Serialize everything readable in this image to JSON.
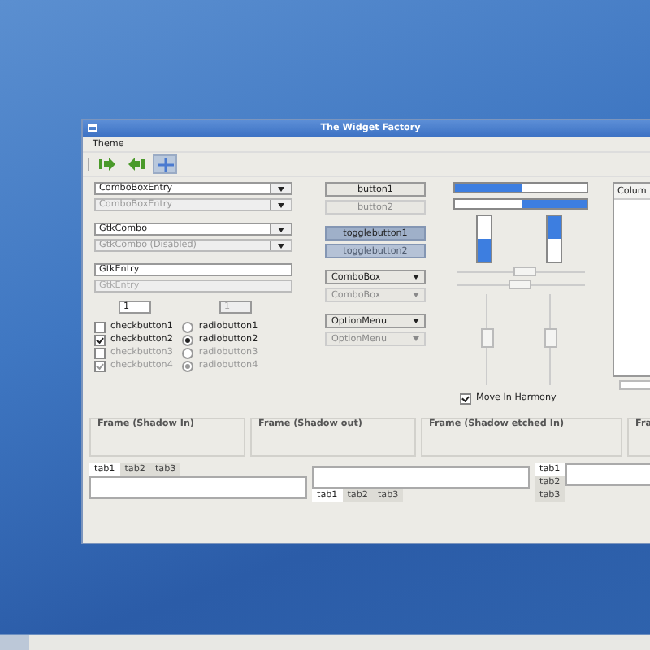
{
  "window": {
    "title": "The Widget Factory"
  },
  "menu": [
    {
      "label": "Theme"
    }
  ],
  "toolbar": [
    {
      "selected": false
    },
    {
      "selected": false
    },
    {
      "selected": true
    }
  ],
  "combos": [
    {
      "text": "ComboBoxEntry",
      "disabled": false
    },
    {
      "text": "ComboBoxEntry",
      "disabled": true
    },
    {
      "text": "GtkCombo",
      "disabled": false
    },
    {
      "text": "GtkCombo (Disabled)",
      "disabled": true
    }
  ],
  "entries": [
    {
      "value": "GtkEntry",
      "disabled": false
    },
    {
      "value": "GtkEntry",
      "disabled": true
    }
  ],
  "spins": [
    {
      "value": "1",
      "disabled": false
    },
    {
      "value": "1",
      "disabled": true
    }
  ],
  "checks": [
    {
      "label": "checkbutton1",
      "checked": false,
      "disabled": false
    },
    {
      "label": "checkbutton2",
      "checked": true,
      "disabled": false
    },
    {
      "label": "checkbutton3",
      "checked": false,
      "disabled": true
    },
    {
      "label": "checkbutton4",
      "checked": true,
      "disabled": true
    }
  ],
  "radios": [
    {
      "label": "radiobutton1",
      "selected": false,
      "disabled": false
    },
    {
      "label": "radiobutton2",
      "selected": true,
      "disabled": false
    },
    {
      "label": "radiobutton3",
      "selected": false,
      "disabled": true
    },
    {
      "label": "radiobutton4",
      "selected": true,
      "disabled": true
    }
  ],
  "buttons": [
    {
      "kind": "button",
      "label": "button1",
      "disabled": false,
      "on": false
    },
    {
      "kind": "button",
      "label": "button2",
      "disabled": true,
      "on": false
    },
    {
      "kind": "toggle",
      "label": "togglebutton1",
      "disabled": false,
      "on": true
    },
    {
      "kind": "toggle",
      "label": "togglebutton2",
      "disabled": true,
      "on": true
    },
    {
      "kind": "combo",
      "label": "ComboBox",
      "disabled": false,
      "on": false
    },
    {
      "kind": "combo",
      "label": "ComboBox",
      "disabled": true,
      "on": false
    },
    {
      "kind": "combo",
      "label": "OptionMenu",
      "disabled": false,
      "on": false
    },
    {
      "kind": "combo",
      "label": "OptionMenu",
      "disabled": true,
      "on": false
    }
  ],
  "hprogress": [
    {
      "level": 0.5,
      "inverted": false
    },
    {
      "level": 0.5,
      "inverted": true
    }
  ],
  "vprogress": [
    {
      "level": 0.5,
      "inverted": false
    },
    {
      "level": 0.5,
      "inverted": true
    }
  ],
  "hscales": [
    {
      "level": 0.55
    },
    {
      "level": 0.5
    }
  ],
  "vscales": [
    {
      "level": 0.5
    },
    {
      "level": 0.5
    }
  ],
  "harmony": {
    "label": "Move In Harmony",
    "checked": true
  },
  "tree": {
    "columns": [
      "Colum"
    ]
  },
  "frames": [
    {
      "label": "Frame (Shadow In)"
    },
    {
      "label": "Frame (Shadow out)"
    },
    {
      "label": "Frame (Shadow etched In)"
    },
    {
      "label": "Fra"
    }
  ],
  "notebooks": [
    {
      "kind": "top",
      "tabs": [
        {
          "label": "tab1",
          "selected": true
        },
        {
          "label": "tab2",
          "selected": false
        },
        {
          "label": "tab3",
          "selected": false
        }
      ]
    },
    {
      "kind": "bottom",
      "tabs": [
        {
          "label": "tab1",
          "selected": true
        },
        {
          "label": "tab2",
          "selected": false
        },
        {
          "label": "tab3",
          "selected": false
        }
      ]
    },
    {
      "kind": "left",
      "tabs": [
        {
          "label": "tab1",
          "selected": true
        },
        {
          "label": "tab2",
          "selected": false
        },
        {
          "label": "tab3",
          "selected": false
        }
      ]
    }
  ]
}
